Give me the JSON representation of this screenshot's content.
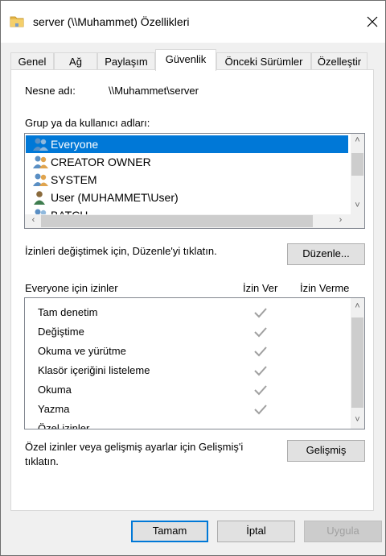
{
  "window": {
    "title": "server (\\\\Muhammet) Özellikleri"
  },
  "tabs": [
    {
      "label": "Genel"
    },
    {
      "label": "Ağ"
    },
    {
      "label": "Paylaşım"
    },
    {
      "label": "Güvenlik"
    },
    {
      "label": "Önceki Sürümler"
    },
    {
      "label": "Özelleştir"
    }
  ],
  "active_tab": "Güvenlik",
  "object": {
    "label": "Nesne adı:",
    "value": "\\\\Muhammet\\server"
  },
  "groups": {
    "label": "Grup ya da kullanıcı adları:",
    "items": [
      {
        "name": "Everyone",
        "icon": "group-icon",
        "selected": true
      },
      {
        "name": "CREATOR OWNER",
        "icon": "group-icon",
        "selected": false
      },
      {
        "name": "SYSTEM",
        "icon": "group-icon",
        "selected": false
      },
      {
        "name": "User (MUHAMMET\\User)",
        "icon": "user-icon",
        "selected": false
      },
      {
        "name": "BATCH",
        "icon": "group-icon",
        "selected": false
      }
    ]
  },
  "edit": {
    "hint": "İzinleri değiştimek için, Düzenle'yi tıklatın.",
    "button": "Düzenle..."
  },
  "permissions": {
    "label": "Everyone için izinler",
    "allow_header": "İzin Ver",
    "deny_header": "İzin Verme",
    "items": [
      {
        "name": "Tam denetim",
        "allow": true,
        "deny": false
      },
      {
        "name": "Değiştime",
        "allow": true,
        "deny": false
      },
      {
        "name": "Okuma ve yürütme",
        "allow": true,
        "deny": false
      },
      {
        "name": "Klasör içeriğini listeleme",
        "allow": true,
        "deny": false
      },
      {
        "name": "Okuma",
        "allow": true,
        "deny": false
      },
      {
        "name": "Yazma",
        "allow": true,
        "deny": false
      },
      {
        "name": "Özel izinler",
        "allow": false,
        "deny": false
      }
    ]
  },
  "advanced": {
    "hint_line1": "Özel izinler veya gelişmiş ayarlar için Gelişmiş'i",
    "hint_line2": "tıklatın.",
    "button": "Gelişmiş"
  },
  "footer": {
    "ok": "Tamam",
    "cancel": "İptal",
    "apply": "Uygula"
  },
  "colors": {
    "selection": "#0078d7",
    "check": "#a0a0a0",
    "folder": "#e8b84a"
  }
}
